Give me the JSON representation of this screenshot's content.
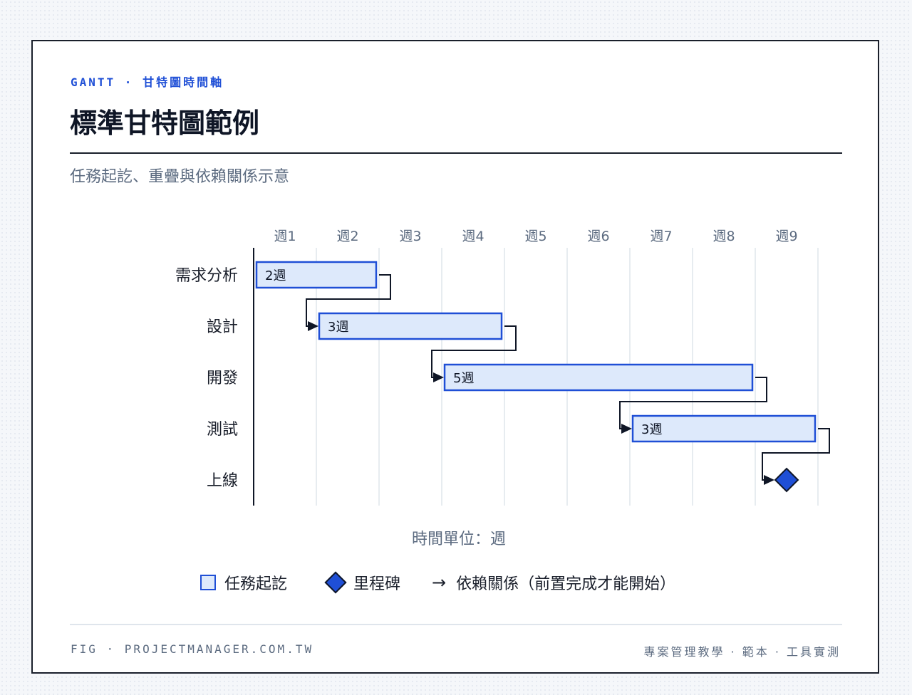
{
  "header": {
    "eyebrow": "GANTT · 甘特圖時間軸",
    "title": "標準甘特圖範例",
    "subtitle": "任務起訖、重疊與依賴關係示意"
  },
  "chart_data": {
    "type": "gantt",
    "weeks": [
      "週1",
      "週2",
      "週3",
      "週4",
      "週5",
      "週6",
      "週7",
      "週8",
      "週9"
    ],
    "tasks": [
      {
        "name": "需求分析",
        "start": 0,
        "duration": 2,
        "label": "2週"
      },
      {
        "name": "設計",
        "start": 1,
        "duration": 3,
        "label": "3週"
      },
      {
        "name": "開發",
        "start": 3,
        "duration": 5,
        "label": "5週"
      },
      {
        "name": "測試",
        "start": 6,
        "duration": 3,
        "label": "3週"
      }
    ],
    "milestone": {
      "name": "上線",
      "week": 8.5
    },
    "dependencies": [
      [
        0,
        1
      ],
      [
        1,
        2
      ],
      [
        2,
        3
      ],
      [
        3,
        "milestone"
      ]
    ],
    "xlabel": "時間單位：週",
    "colors": {
      "bar_fill": "#dde9fb",
      "bar_stroke": "#1f4fd6",
      "milestone_fill": "#1f4fd6",
      "line": "#0f1626",
      "grid": "#dfe6ec",
      "tick_text": "#5c6b80"
    }
  },
  "legend": {
    "task": "任務起訖",
    "milestone": "里程碑",
    "arrow": "→",
    "dependency": "依賴關係（前置完成才能開始）"
  },
  "footer": {
    "left": "FIG · PROJECTMANAGER.COM.TW",
    "right": "專案管理教學 · 範本 · 工具實測"
  }
}
